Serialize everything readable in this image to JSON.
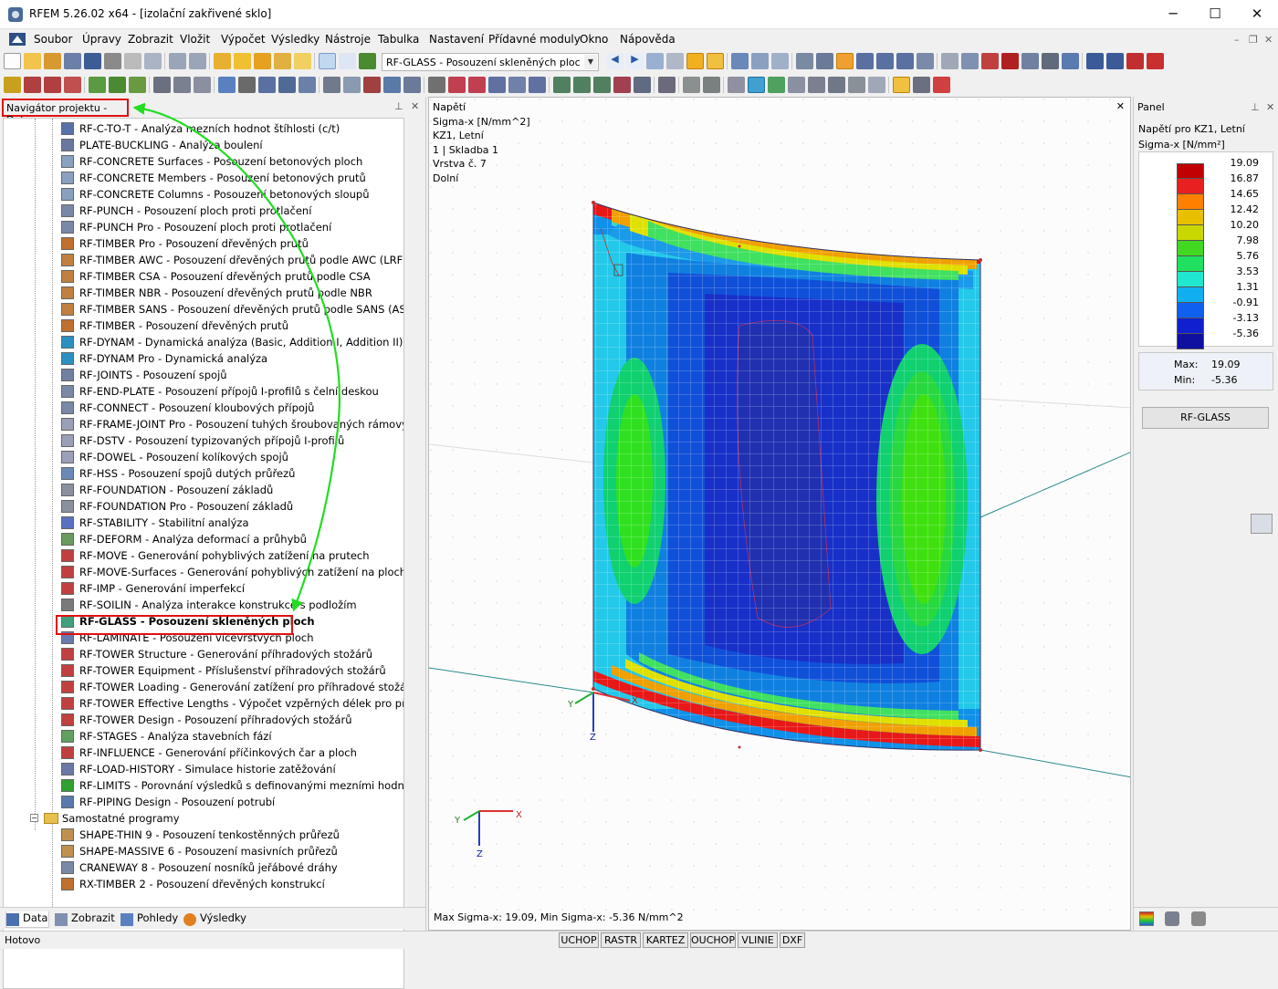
{
  "window": {
    "title": "RFEM 5.26.02 x64 - [izolační zakřivené sklo]",
    "minimize": "─",
    "maximize": "☐",
    "close": "✕"
  },
  "menu": {
    "items": [
      "Soubor",
      "Úpravy",
      "Zobrazit",
      "Vložit",
      "Výpočet",
      "Výsledky",
      "Nástroje",
      "Tabulka",
      "Nastavení",
      "Přídavné moduly",
      "Okno",
      "Nápověda"
    ],
    "mdi_min": "–",
    "mdi_restore": "❐",
    "mdi_close": "✕"
  },
  "toolbar": {
    "module_combo": "RF-GLASS - Posouzení skleněných ploc"
  },
  "navigator": {
    "title": "Navigátor projektu - Data",
    "pin": "⊥",
    "close": "✕",
    "items": [
      "RF-C-TO-T - Analýza mezních hodnot štíhlosti (c/t)",
      "PLATE-BUCKLING - Analýza boulení",
      "RF-CONCRETE Surfaces - Posouzení betonových ploch",
      "RF-CONCRETE Members - Posouzení betonových prutů",
      "RF-CONCRETE Columns - Posouzení betonových sloupů",
      "RF-PUNCH - Posouzení ploch proti protlačení",
      "RF-PUNCH Pro - Posouzení ploch proti protlačení",
      "RF-TIMBER Pro - Posouzení dřevěných prutů",
      "RF-TIMBER AWC - Posouzení dřevěných prutů podle AWC (LRFD ne",
      "RF-TIMBER CSA - Posouzení dřevěných prutů podle CSA",
      "RF-TIMBER NBR - Posouzení dřevěných prutů podle NBR",
      "RF-TIMBER SANS - Posouzení dřevěných prutů podle SANS (ASD nel",
      "RF-TIMBER - Posouzení dřevěných prutů",
      "RF-DYNAM - Dynamická analýza (Basic, Addition I, Addition II)",
      "RF-DYNAM Pro - Dynamická analýza",
      "RF-JOINTS - Posouzení spojů",
      "RF-END-PLATE - Posouzení přípojů I-profilů s čelní deskou",
      "RF-CONNECT - Posouzení kloubových přípojů",
      "RF-FRAME-JOINT Pro - Posouzení tuhých šroubovaných rámových r",
      "RF-DSTV - Posouzení typizovaných přípojů I-profilů",
      "RF-DOWEL - Posouzení kolíkových spojů",
      "RF-HSS - Posouzení spojů dutých průřezů",
      "RF-FOUNDATION - Posouzení základů",
      "RF-FOUNDATION Pro - Posouzení základů",
      "RF-STABILITY - Stabilitní analýza",
      "RF-DEFORM - Analýza deformací a průhybů",
      "RF-MOVE - Generování pohyblivých zatížení na prutech",
      "RF-MOVE-Surfaces - Generování pohyblivých zatížení na plochy",
      "RF-IMP - Generování imperfekcí",
      "RF-SOILIN - Analýza interakce konstrukce s podložím",
      "RF-GLASS - Posouzení skleněných ploch",
      "RF-LAMINATE - Posouzení vícevrstvých ploch",
      "RF-TOWER Structure - Generování příhradových stožárů",
      "RF-TOWER Equipment - Příslušenství příhradových stožárů",
      "RF-TOWER Loading - Generování zatížení pro příhradové stožáry",
      "RF-TOWER Effective Lengths - Výpočet vzpěrných délek pro příhrado",
      "RF-TOWER Design - Posouzení příhradových stožárů",
      "RF-STAGES - Analýza stavebních fází",
      "RF-INFLUENCE - Generování příčinkových čar a ploch",
      "RF-LOAD-HISTORY - Simulace historie zatěžování",
      "RF-LIMITS - Porovnání výsledků s definovanými mezními hodnotam",
      "RF-PIPING Design - Posouzení potrubí"
    ],
    "folder_label": "Samostatné programy",
    "folder_expander": "−",
    "standalone_items": [
      "SHAPE-THIN 9 - Posouzení tenkostěnných průřezů",
      "SHAPE-MASSIVE 6 - Posouzení masivních průřezů",
      "CRANEWAY 8 - Posouzení nosníků jeřábové dráhy",
      "RX-TIMBER 2 - Posouzení dřevěných konstrukcí"
    ],
    "scroll_up": "▲",
    "scroll_down": "▼",
    "scroll_left": "◀",
    "scroll_right": "▶",
    "tabs": [
      "Data",
      "Zobrazit",
      "Pohledy",
      "Výsledky"
    ]
  },
  "view": {
    "info_lines": [
      "Napětí",
      "Sigma-x [N/mm^2]",
      "KZ1, Letní",
      "1 | Skladba 1",
      "Vrstva č. 7",
      "Dolní"
    ],
    "bottom_text": "Max Sigma-x: 19.09, Min Sigma-x: -5.36 N/mm^2",
    "axis_labels": {
      "x": "X",
      "y": "Y",
      "z": "Z"
    },
    "close": "✕"
  },
  "panel": {
    "title": "Panel",
    "pin": "⊥",
    "close": "✕",
    "heading1": "Napětí pro KZ1, Letní",
    "heading2": "Sigma-x [N/mm²]",
    "legend": [
      {
        "value": "19.09",
        "color": "#c00000"
      },
      {
        "value": "16.87",
        "color": "#e82020"
      },
      {
        "value": "14.65",
        "color": "#ff8000"
      },
      {
        "value": "12.42",
        "color": "#e8c000"
      },
      {
        "value": "10.20",
        "color": "#c8d800"
      },
      {
        "value": "7.98",
        "color": "#40d820"
      },
      {
        "value": "5.76",
        "color": "#20e060"
      },
      {
        "value": "3.53",
        "color": "#20e8d0"
      },
      {
        "value": "1.31",
        "color": "#10b0f0"
      },
      {
        "value": "-0.91",
        "color": "#1060f0"
      },
      {
        "value": "-3.13",
        "color": "#1020d0"
      },
      {
        "value": "-5.36",
        "color": "#1010a0"
      }
    ],
    "max_label": "Max:",
    "max_value": "19.09",
    "min_label": "Min:",
    "min_value": "-5.36",
    "button": "RF-GLASS"
  },
  "status": {
    "text": "Hotovo",
    "buttons": [
      "UCHOP",
      "RASTR",
      "KARTEZ",
      "OUCHOP",
      "VLINIE",
      "DXF"
    ]
  }
}
